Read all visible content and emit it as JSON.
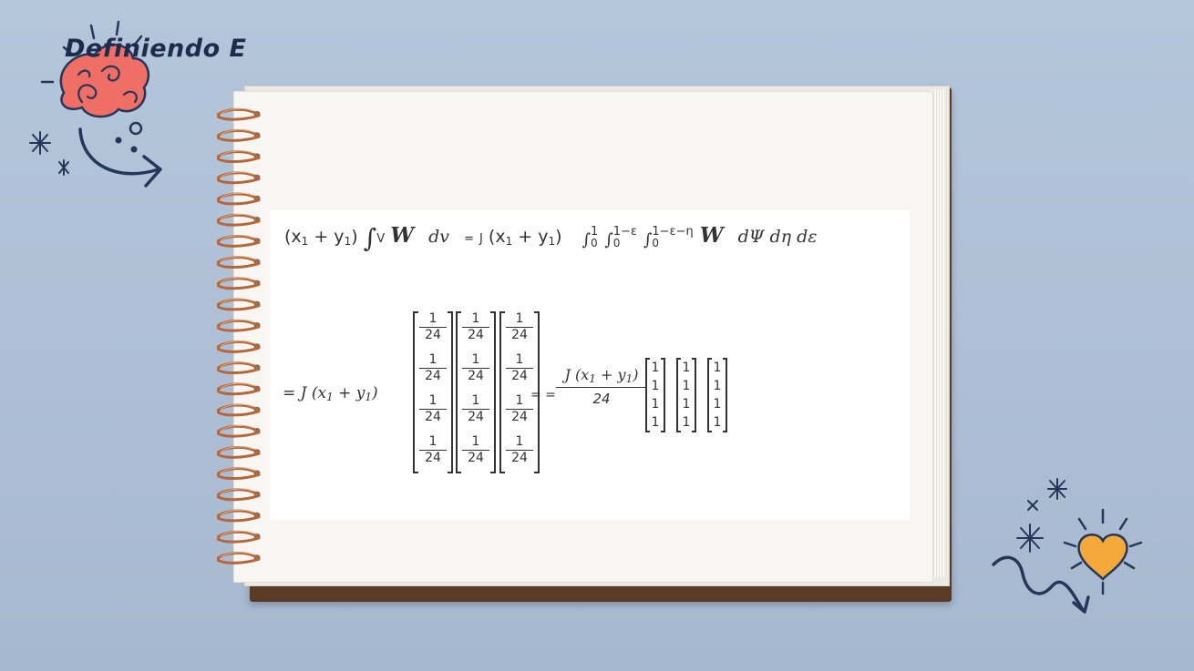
{
  "slide": {
    "title": "Definiendo E"
  },
  "equation1": {
    "lhs_open": "(x",
    "lhs_sub1": "1",
    "lhs_plus": " + y",
    "lhs_sub2": "1",
    "lhs_close": ")",
    "lhs_integral": "∫",
    "lhs_domain": "V",
    "w": "W",
    "dv": "dv",
    "equals": "=",
    "jacobian": "J",
    "rhs_open": "(x",
    "rhs_sub1": "1",
    "rhs_plus": " + y",
    "rhs_sub2": "1",
    "rhs_close": ")",
    "integral_symbol": "∫",
    "int1_upper": "1",
    "int1_lower": "0",
    "int2_upper": "1−ε",
    "int2_lower": "0",
    "int3_upper": "1−ε−η",
    "int3_lower": "0",
    "differentials": "dΨ dη dε"
  },
  "equation2": {
    "lhs": "= J (x",
    "lhs_sub1": "1",
    "lhs_plus": " + y",
    "lhs_sub2": "1",
    "lhs_close": ")",
    "entry_numerator": "1",
    "entry_denominator": "24",
    "equals": "= =",
    "frac_numerator": "J (x",
    "frac_num_sub1": "1",
    "frac_num_plus": " + y",
    "frac_num_sub2": "1",
    "frac_num_close": ")",
    "frac_denominator": "24",
    "ones_entry": "1"
  },
  "colors": {
    "background": "#b4c6da",
    "title": "#1f2b4c",
    "doodle_navy": "#24365a",
    "brain": "#ef6f66",
    "heart": "#f6a93b",
    "cover": "#5b3a26",
    "spiral": "#b5663a"
  }
}
